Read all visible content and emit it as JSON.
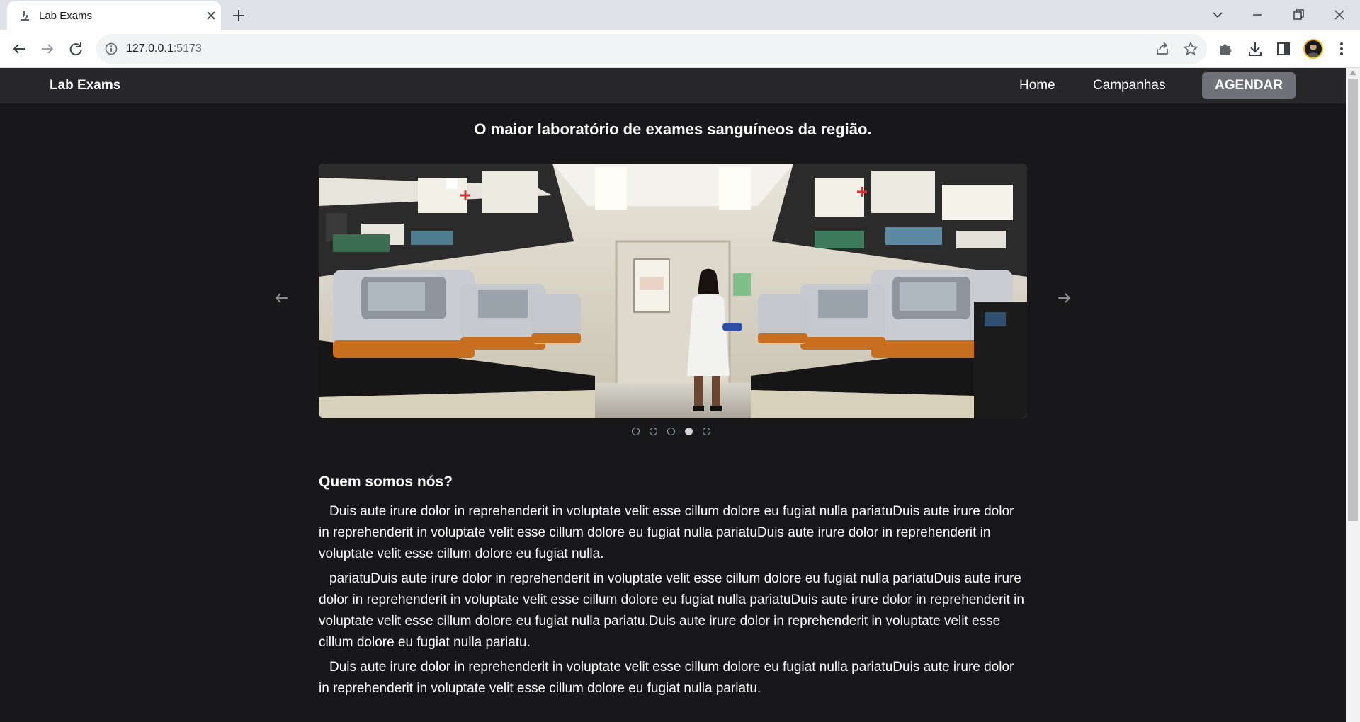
{
  "browser": {
    "tab_title": "Lab Exams",
    "url_host": "127.0.0.1",
    "url_port": ":5173"
  },
  "app": {
    "brand": "Lab Exams",
    "nav": {
      "home": "Home",
      "campanhas": "Campanhas",
      "agendar": "AGENDAR"
    },
    "headline": "O maior laboratório de exames sanguíneos da região.",
    "carousel": {
      "slide_count": 5,
      "active_index": 3
    },
    "about": {
      "title": "Quem somos nós?",
      "paragraphs": [
        "Duis aute irure dolor in reprehenderit in voluptate velit esse cillum dolore eu fugiat nulla pariatuDuis aute irure dolor in reprehenderit in voluptate velit esse cillum dolore eu fugiat nulla pariatuDuis aute irure dolor in reprehenderit in voluptate velit esse cillum dolore eu fugiat nulla.",
        "pariatuDuis aute irure dolor in reprehenderit in voluptate velit esse cillum dolore eu fugiat nulla pariatuDuis aute irure dolor in reprehenderit in voluptate velit esse cillum dolore eu fugiat nulla pariatuDuis aute irure dolor in reprehenderit in voluptate velit esse cillum dolore eu fugiat nulla pariatu.Duis aute irure dolor in reprehenderit in voluptate velit esse cillum dolore eu fugiat nulla pariatu.",
        "Duis aute irure dolor in reprehenderit in voluptate velit esse cillum dolore eu fugiat nulla pariatuDuis aute irure dolor in reprehenderit in voluptate velit esse cillum dolore eu fugiat nulla pariatu."
      ]
    }
  },
  "colors": {
    "page_bg": "#18181b",
    "nav_bg": "#27272a",
    "button_bg": "#71717a"
  }
}
